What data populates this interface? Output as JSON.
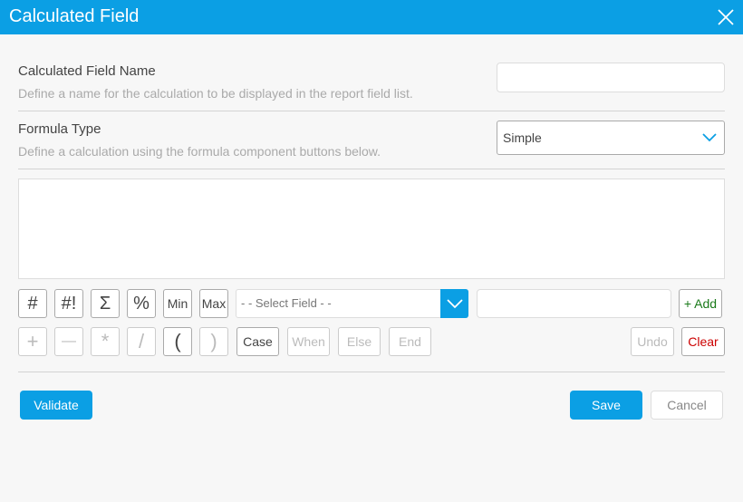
{
  "dialog": {
    "title": "Calculated Field",
    "close_icon": "close-icon"
  },
  "name_section": {
    "label": "Calculated Field Name",
    "description": "Define a name for the calculation to be displayed in the report field list.",
    "value": ""
  },
  "formula_type": {
    "label": "Formula Type",
    "description": "Define a calculation using the formula component buttons below.",
    "selected": "Simple"
  },
  "toolbar_row1": {
    "hash": "#",
    "hash_bang": "#!",
    "sigma": "Σ",
    "percent": "%",
    "min": "Min",
    "max": "Max",
    "field_select": "- - Select Field - -",
    "add": "+ Add"
  },
  "toolbar_row2": {
    "plus": "+",
    "minus": "—",
    "multiply": "*",
    "divide": "/",
    "open_paren": "(",
    "close_paren": ")",
    "case": "Case",
    "when": "When",
    "else": "Else",
    "end": "End",
    "undo": "Undo",
    "clear": "Clear"
  },
  "footer": {
    "validate": "Validate",
    "save": "Save",
    "cancel": "Cancel"
  },
  "colors": {
    "accent": "#0b9fe4",
    "add": "#1a7a1a",
    "clear": "#cc0000"
  }
}
